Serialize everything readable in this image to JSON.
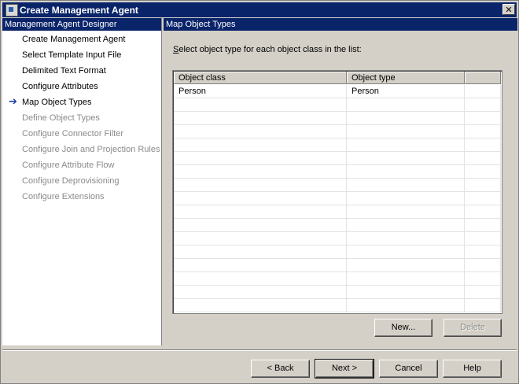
{
  "window": {
    "title": "Create Management Agent",
    "close_label": "✕"
  },
  "left": {
    "header": "Management Agent Designer",
    "current_marker": "➔",
    "items": [
      {
        "label": "Create Management Agent",
        "enabled": true
      },
      {
        "label": "Select Template Input File",
        "enabled": true
      },
      {
        "label": "Delimited Text Format",
        "enabled": true
      },
      {
        "label": "Configure Attributes",
        "enabled": true
      },
      {
        "label": "Map Object Types",
        "enabled": true,
        "current": true
      },
      {
        "label": "Define Object Types",
        "enabled": false
      },
      {
        "label": "Configure Connector Filter",
        "enabled": false
      },
      {
        "label": "Configure Join and Projection Rules",
        "enabled": false
      },
      {
        "label": "Configure Attribute Flow",
        "enabled": false
      },
      {
        "label": "Configure Deprovisioning",
        "enabled": false
      },
      {
        "label": "Configure Extensions",
        "enabled": false
      }
    ]
  },
  "right": {
    "header": "Map Object Types",
    "instruction_first": "S",
    "instruction_rest": "elect object type for each object class in the list:",
    "table": {
      "columns": [
        "Object class",
        "Object type"
      ],
      "rows": [
        [
          "Person",
          "Person"
        ]
      ]
    },
    "new_label": "New...",
    "delete_label": "Delete"
  },
  "footer": {
    "back_label": "< Back",
    "next_label": "Next >",
    "cancel_label": "Cancel",
    "help_label": "Help"
  }
}
